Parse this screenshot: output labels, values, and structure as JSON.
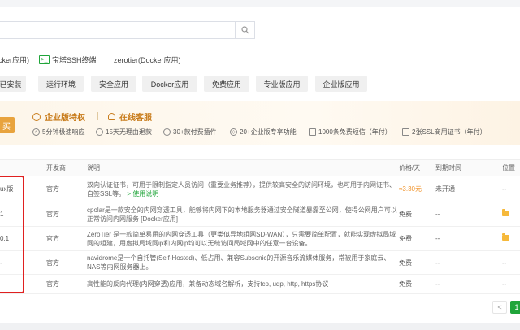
{
  "search": {
    "placeholder": "",
    "button_icon": "search-icon"
  },
  "quick_links": [
    {
      "label": "cker应用)",
      "icon": ""
    },
    {
      "label": "宝塔SSH终端",
      "icon": "terminal-icon"
    },
    {
      "label": "zerotier(Docker应用)",
      "icon": ""
    }
  ],
  "categories": [
    "已安装",
    "运行环境",
    "安全应用",
    "Docker应用",
    "免费应用",
    "专业版应用",
    "企业版应用"
  ],
  "banner": {
    "buy_label": "买",
    "title_enterprise": "企业版特权",
    "title_service": "在线客服",
    "features": [
      "5分钟极速响应",
      "15天无理由退款",
      "30+款付费插件",
      "20+企业版专享功能",
      "1000条免费短信（年付）",
      "2张SSL商用证书（年付）"
    ]
  },
  "table": {
    "headers": [
      "",
      "开发商",
      "说明",
      "价格/天",
      "到期时间",
      "位置"
    ],
    "rows": [
      {
        "name": "ux版",
        "dev": "官方",
        "desc": "双向认证证书，可用于限制指定人员访问（重要业务推荐），提供较高安全的访问环境，也可用于内网证书、自签SSL等。",
        "link": "> 使用说明",
        "price": "≈3.30元",
        "expire": "未开通",
        "loc": "--",
        "folder": false
      },
      {
        "name": "1",
        "dev": "官方",
        "desc": "cpolar是一款安全的内网穿透工具，能够将内网下的本地服务器通过安全隧道暴露至公网，使得公网用户可以正常访问内网服务 [Docker应用]",
        "link": "",
        "price": "免费",
        "expire": "--",
        "loc": "",
        "folder": true
      },
      {
        "name": "0.1",
        "dev": "官方",
        "desc": "ZeroTier 是一款简单易用的内网穿透工具（更类似异地组网SD-WAN），只需要简单配置，就能实现虚拟局域网的组建，用虚拟局域网ip和内网ip均可以无缝访问局域网中的任意一台设备。",
        "link": "",
        "price": "免费",
        "expire": "--",
        "loc": "",
        "folder": true
      },
      {
        "name": "-",
        "dev": "官方",
        "desc": "navidrome是一个自托管(Self-Hosted)、低占用、兼容Subsonic的开源音乐流媒体服务，常被用于家庭云、NAS等内网服务器上。",
        "link": "",
        "price": "免费",
        "expire": "--",
        "loc": "--",
        "folder": false
      },
      {
        "name": "",
        "dev": "官方",
        "desc": "高性能的反向代理(内网穿透)应用，兼备动态域名解析，支持tcp, udp, http, https协议",
        "link": "",
        "price": "免费",
        "expire": "--",
        "loc": "--",
        "folder": false
      }
    ]
  },
  "pager": {
    "prev": "<",
    "current": "1"
  },
  "colors": {
    "accent": "#20a53a",
    "banner_gold": "#c87b1a",
    "highlight": "#e02020"
  }
}
